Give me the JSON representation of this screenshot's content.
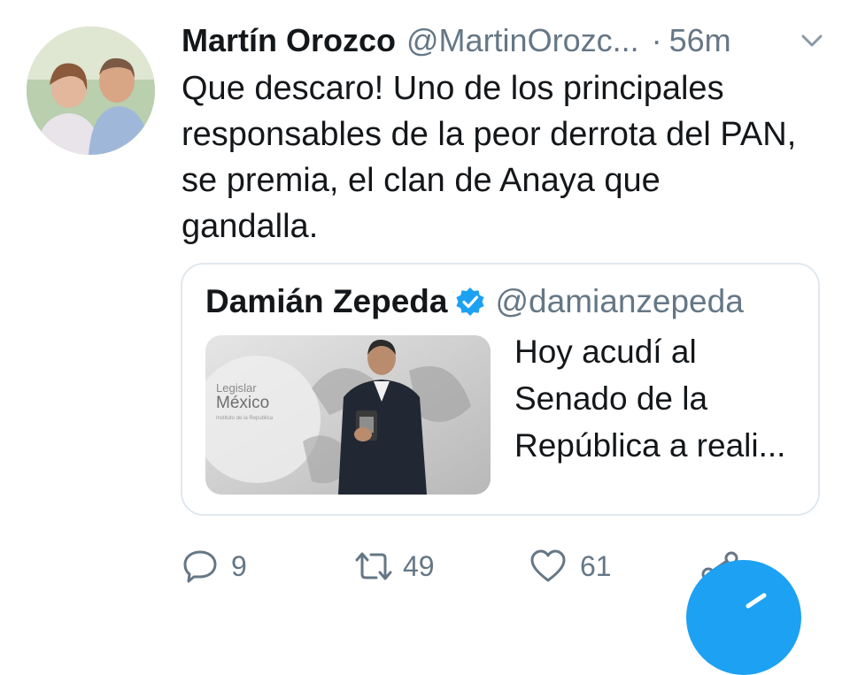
{
  "tweet": {
    "author_name": "Martín Orozco",
    "author_handle": "@MartinOrozc...",
    "separator": "·",
    "time": "56m",
    "text": "Que  descaro! Uno de los principales\nresponsables de la peor derrota del PAN,\nse premia,  el clan de Anaya que\ngandalla."
  },
  "quoted": {
    "author_name": "Damián Zepeda",
    "author_handle": "@damianzepeda",
    "verified": true,
    "text": "Hoy acudí al\nSenado de la\nRepública a reali...",
    "image_text": {
      "line1": "Legislar",
      "line2": "México",
      "line3": "Instituto de la Republica"
    }
  },
  "actions": {
    "reply_count": "9",
    "retweet_count": "49",
    "like_count": "61"
  },
  "colors": {
    "accent": "#1da1f2",
    "text_primary": "#14171a",
    "text_secondary": "#657786",
    "border": "#e1e8ed"
  },
  "icons": [
    "chevron-down-icon",
    "verified-badge-icon",
    "reply-icon",
    "retweet-icon",
    "like-icon",
    "share-icon",
    "compose-icon"
  ]
}
